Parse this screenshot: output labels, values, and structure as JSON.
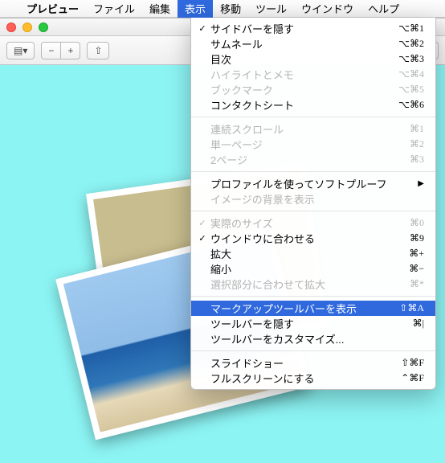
{
  "menubar": {
    "app": "プレビュー",
    "items": [
      "ファイル",
      "編集",
      "表示",
      "移動",
      "ツール",
      "ウインドウ",
      "ヘルプ"
    ],
    "open_index": 2
  },
  "toolbar": {
    "sidebar_icon": "▤▾",
    "zoom_out": "−",
    "zoom_in": "+",
    "share": "⇧",
    "edit": "✎"
  },
  "menu": {
    "g1": [
      {
        "check": true,
        "label": "サイドバーを隠す",
        "shortcut": "⌥⌘1"
      },
      {
        "check": false,
        "label": "サムネール",
        "shortcut": "⌥⌘2"
      },
      {
        "check": false,
        "label": "目次",
        "shortcut": "⌥⌘3"
      },
      {
        "check": false,
        "label": "ハイライトとメモ",
        "shortcut": "⌥⌘4",
        "disabled": true
      },
      {
        "check": false,
        "label": "ブックマーク",
        "shortcut": "⌥⌘5",
        "disabled": true
      },
      {
        "check": false,
        "label": "コンタクトシート",
        "shortcut": "⌥⌘6"
      }
    ],
    "g2": [
      {
        "label": "連続スクロール",
        "shortcut": "⌘1",
        "disabled": true
      },
      {
        "label": "単一ページ",
        "shortcut": "⌘2",
        "disabled": true
      },
      {
        "label": "2ページ",
        "shortcut": "⌘3",
        "disabled": true
      }
    ],
    "g3": [
      {
        "label": "プロファイルを使ってソフトプルーフ",
        "submenu": true
      },
      {
        "label": "イメージの背景を表示",
        "disabled": true
      }
    ],
    "g4": [
      {
        "check": true,
        "label": "実際のサイズ",
        "shortcut": "⌘0",
        "disabled": true
      },
      {
        "check": true,
        "label": "ウインドウに合わせる",
        "shortcut": "⌘9"
      },
      {
        "label": "拡大",
        "shortcut": "⌘+"
      },
      {
        "label": "縮小",
        "shortcut": "⌘−"
      },
      {
        "label": "選択部分に合わせて拡大",
        "shortcut": "⌘*",
        "disabled": true
      }
    ],
    "g5": [
      {
        "label": "マークアップツールバーを表示",
        "shortcut": "⇧⌘A",
        "selected": true
      },
      {
        "label": "ツールバーを隠す",
        "shortcut": "⌘|"
      },
      {
        "label": "ツールバーをカスタマイズ..."
      }
    ],
    "g6": [
      {
        "label": "スライドショー",
        "shortcut": "⇧⌘F"
      },
      {
        "label": "フルスクリーンにする",
        "shortcut": "⌃⌘F"
      }
    ]
  }
}
